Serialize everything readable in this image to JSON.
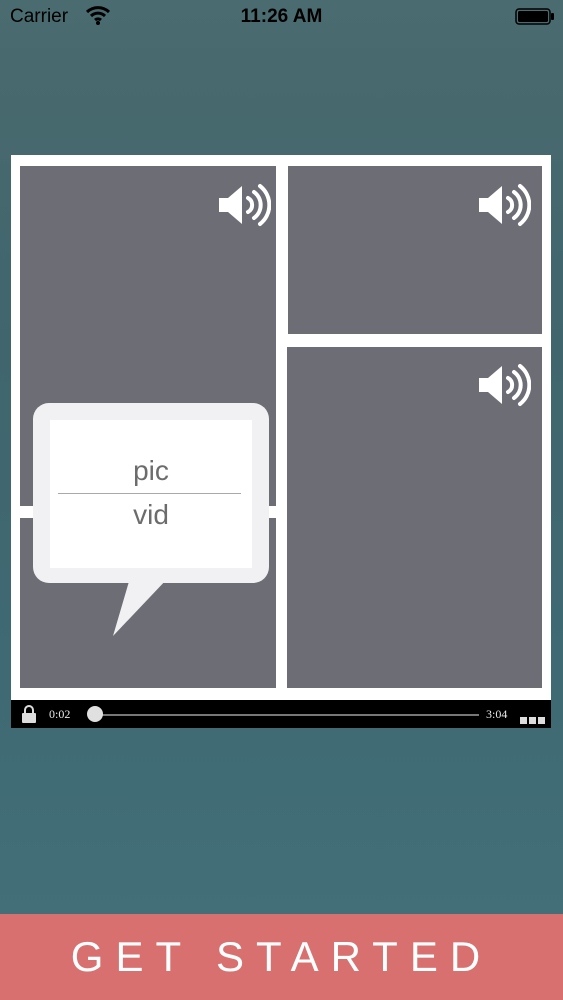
{
  "status_bar": {
    "carrier": "Carrier",
    "time": "11:26 AM"
  },
  "icons": {
    "wifi": "wifi-icon",
    "battery": "battery-icon",
    "speaker": "speaker-icon",
    "lock": "lock-icon",
    "menu": "more-dots-icon"
  },
  "player": {
    "elapsed": "0:02",
    "duration": "3:04",
    "progress": 0.011
  },
  "popup": {
    "option_pic": "pic",
    "option_vid": "vid"
  },
  "cta": {
    "label": "GET STARTED"
  },
  "colors": {
    "tile": "#6d6e75",
    "cta": "#d97070",
    "frame": "#ffffff"
  }
}
